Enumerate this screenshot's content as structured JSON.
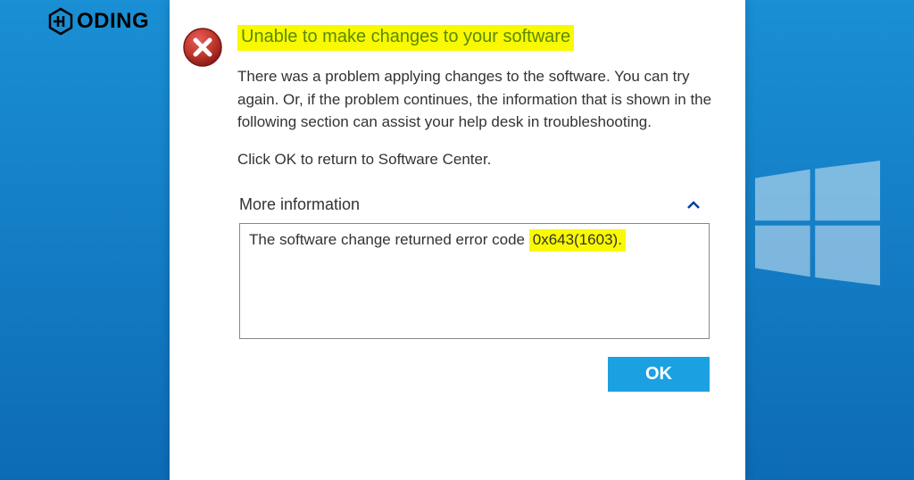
{
  "watermark": {
    "brand": "ODING"
  },
  "dialog": {
    "title": "Unable to make changes to your software",
    "body_paragraph1": "There was a problem applying changes to the software.  You can try again. Or, if the problem continues, the information that is shown in the following section can assist your help desk in troubleshooting.",
    "body_paragraph2": "Click OK to return to Software Center.",
    "more_info_label": "More information",
    "error_prefix": "The software change returned error code ",
    "error_code": "0x643(1603).",
    "ok_label": "OK"
  }
}
